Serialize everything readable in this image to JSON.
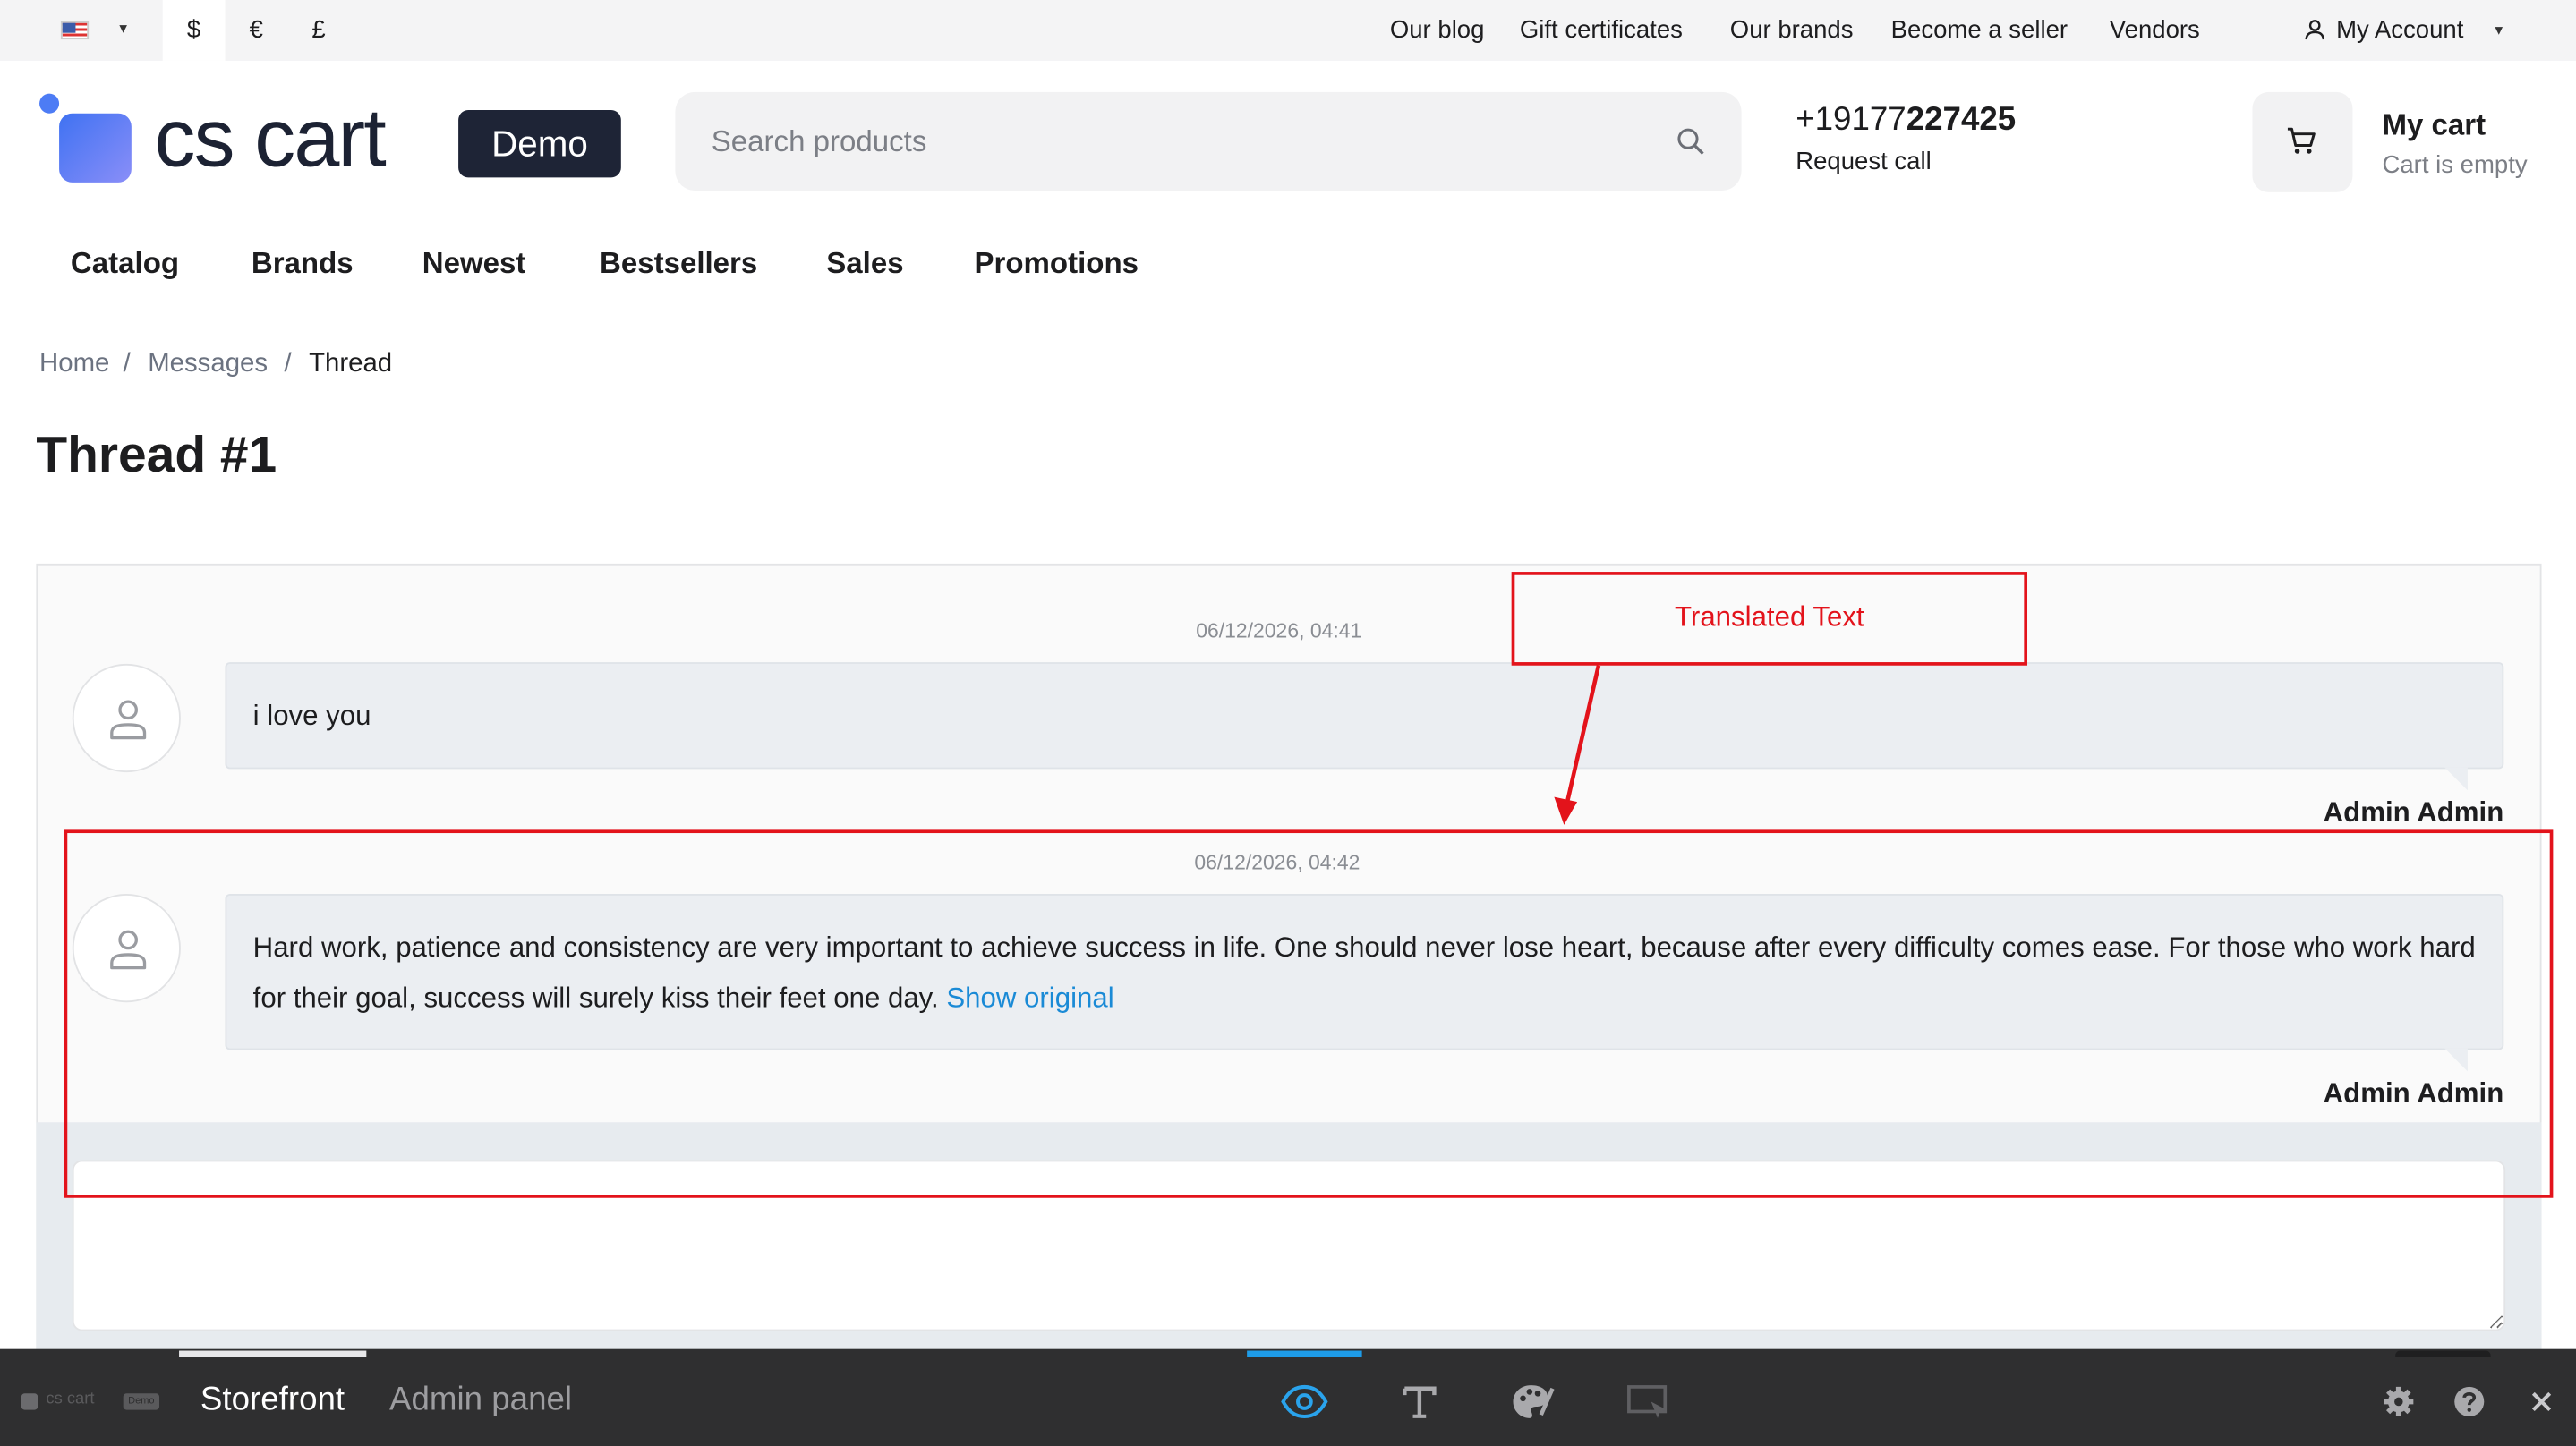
{
  "topbar": {
    "currencies": [
      "$",
      "€",
      "£"
    ],
    "links": [
      "Our blog",
      "Gift certificates",
      "Our brands",
      "Become a seller",
      "Vendors"
    ],
    "account_label": "My Account"
  },
  "header": {
    "logo_text": "cs cart",
    "demo_badge": "Demo",
    "search_placeholder": "Search products",
    "phone_prefix": "+19177",
    "phone_bold": "227425",
    "request_call": "Request call",
    "cart_title": "My cart",
    "cart_status": "Cart is empty"
  },
  "nav": {
    "items": [
      "Catalog",
      "Brands",
      "Newest",
      "Bestsellers",
      "Sales",
      "Promotions"
    ]
  },
  "breadcrumb": {
    "home": "Home",
    "messages": "Messages",
    "sep": "/",
    "current": "Thread"
  },
  "page": {
    "title": "Thread #1"
  },
  "messages": [
    {
      "time": "06/12/2026, 04:41",
      "text": "i love you",
      "author": "Admin Admin"
    },
    {
      "time": "06/12/2026, 04:42",
      "text": "Hard work, patience and consistency are very important to achieve success in life. One should never lose heart, because after every difficulty comes ease. For those who work hard for their goal, success will surely kiss their feet one day.",
      "link": "Show original",
      "author": "Admin Admin"
    }
  ],
  "annotation": {
    "label": "Translated Text",
    "color": "#e3131b"
  },
  "bottombar": {
    "mini_logo": "cs cart",
    "mini_badge": "Demo",
    "tab_storefront": "Storefront",
    "tab_admin": "Admin panel"
  },
  "colors": {
    "accent_link": "#1a8ad6",
    "dark_badge": "#1e2436",
    "bottombar_bg": "#2f2f30",
    "active_indicator": "#1e9ce8"
  }
}
